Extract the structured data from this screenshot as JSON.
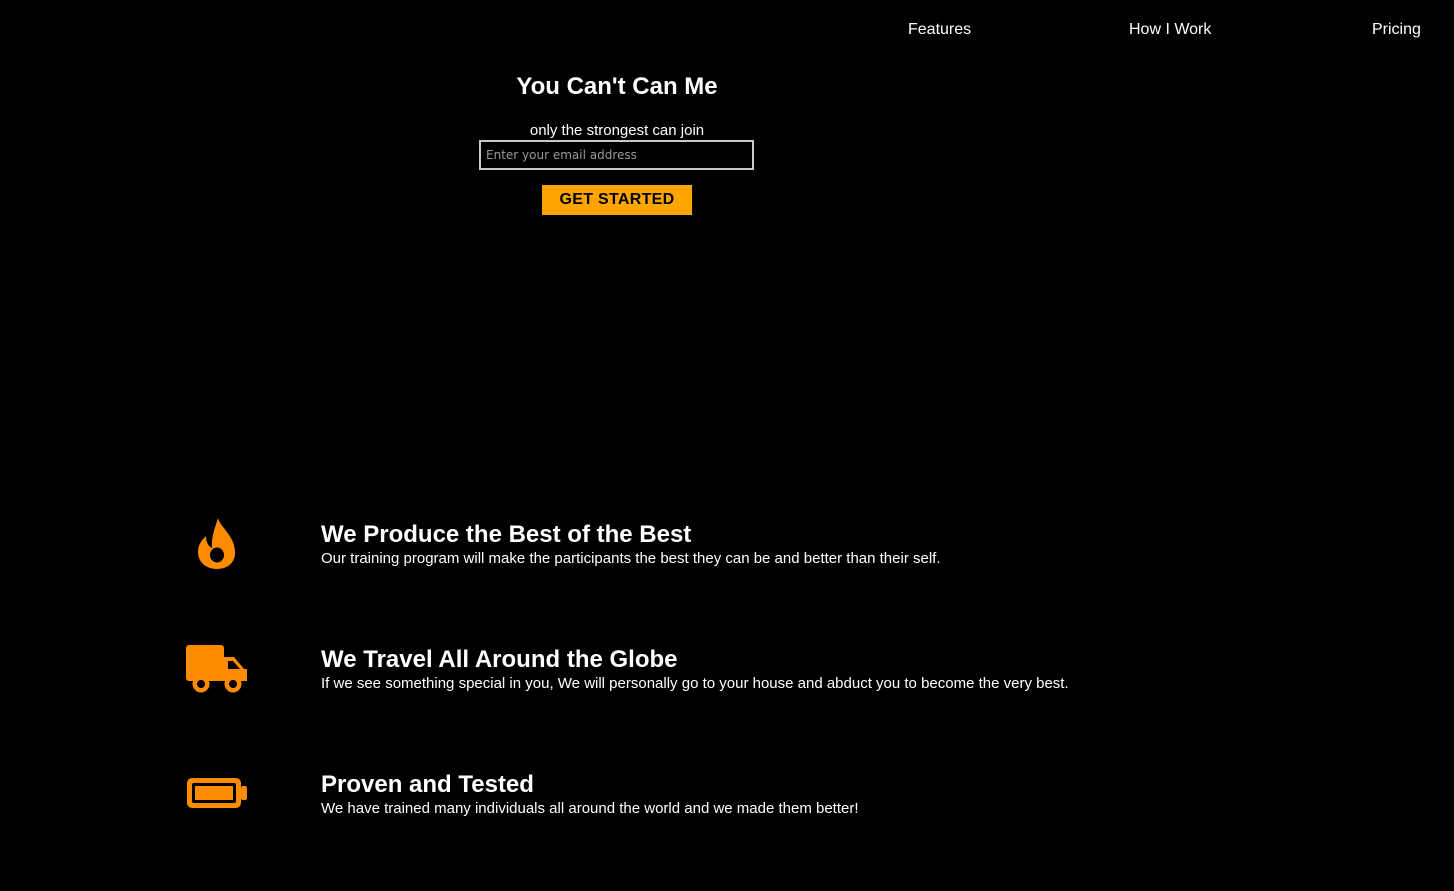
{
  "nav": {
    "items": [
      {
        "label": "Features"
      },
      {
        "label": "How I Work"
      },
      {
        "label": "Pricing"
      }
    ]
  },
  "hero": {
    "title": "You Can't Can Me",
    "subtitle": "only the strongest can join",
    "email_placeholder": "Enter your email address",
    "email_value": "",
    "cta_label": "GET STARTED"
  },
  "features": [
    {
      "icon": "fire-icon",
      "title": "We Produce the Best of the Best",
      "description": "Our training program will make the participants the best they can be and better than their self."
    },
    {
      "icon": "truck-icon",
      "title": "We Travel All Around the Globe",
      "description": "If we see something special in you, We will personally go to your house and abduct you to become the very best."
    },
    {
      "icon": "battery-full-icon",
      "title": "Proven and Tested",
      "description": "We have trained many individuals all around the world and we made them better!"
    }
  ],
  "colors": {
    "background": "#000000",
    "text": "#ffffff",
    "accent": "#ffa500",
    "icon": "#ff8c00"
  }
}
